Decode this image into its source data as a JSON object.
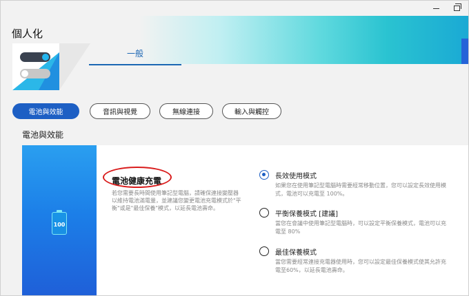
{
  "window": {
    "title": "個人化",
    "minimize_icon": "minimize-icon",
    "restore_icon": "restore-icon"
  },
  "tabs": {
    "main": "一般"
  },
  "categories": [
    {
      "label": "電池與效能",
      "active": true
    },
    {
      "label": "音訊與視覺",
      "active": false
    },
    {
      "label": "無線連接",
      "active": false
    },
    {
      "label": "輸入與觸控",
      "active": false
    }
  ],
  "section": {
    "heading": "電池與效能"
  },
  "battery": {
    "value": "100",
    "icon": "battery-icon"
  },
  "feature": {
    "title": "電池健康充電",
    "description": "若您需要長時間使用筆記型電腦，請確保連接變壓器以維持電池滿電量，並建議您變更電池充電模式於\"平衡\"或是\"最佳保養\"模式，以延長電池壽命。"
  },
  "options": [
    {
      "label": "長效使用模式",
      "description": "如果您在使用筆記型電腦時需要經常移動位置，您可以設定長效使用模式，電池可以充電至 100%。",
      "checked": true
    },
    {
      "label": "平衡保養模式 [建議]",
      "description": "當您在會議中使用筆記型電腦時，可以設定平衡保養模式，電池可以充電至 80%",
      "checked": false
    },
    {
      "label": "最佳保養模式",
      "description": "當您需要經常連接充電器使用時，您可以設定最佳保養模式使其允許充電至60%，以延長電池壽命。",
      "checked": false
    }
  ],
  "colors": {
    "accent": "#1d5fc4",
    "annotation": "#d91b1b"
  }
}
